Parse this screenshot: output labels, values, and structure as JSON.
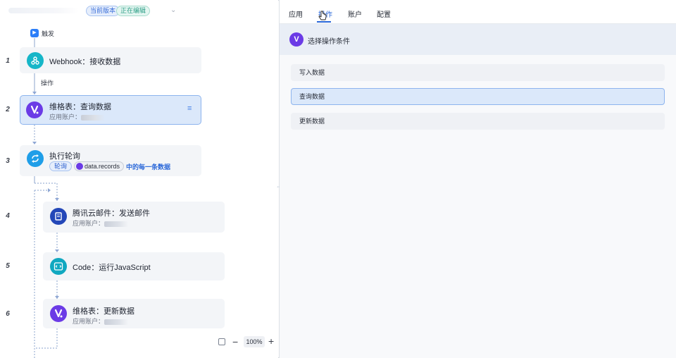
{
  "header": {
    "badge_current": "当前版本",
    "badge_editing": "正在编辑"
  },
  "trigger": {
    "label": "触发"
  },
  "connector": {
    "operation_label": "操作"
  },
  "steps": [
    {
      "number": "1",
      "title": "Webhook：接收数据",
      "icon": "webhook-icon"
    },
    {
      "number": "2",
      "title": "维格表：查询数据",
      "subtitle": "应用账户：",
      "icon": "vika-icon",
      "selected": true
    },
    {
      "number": "3",
      "title": "执行轮询",
      "icon": "loop-icon",
      "chip_poll": "轮询",
      "chip_data": "data.records",
      "chip_suffix": "中的每一条数据"
    },
    {
      "number": "4",
      "title": "腾讯云邮件：发送邮件",
      "subtitle": "应用账户：",
      "icon": "mail-icon"
    },
    {
      "number": "5",
      "title": "Code：运行JavaScript",
      "icon": "code-icon"
    },
    {
      "number": "6",
      "title": "维格表：更新数据",
      "subtitle": "应用账户：",
      "icon": "vika-icon"
    }
  ],
  "zoom": {
    "value": "100%",
    "minus": "−",
    "plus": "+"
  },
  "tabs": [
    {
      "label": "应用"
    },
    {
      "label": "操作",
      "active": true
    },
    {
      "label": "账户"
    },
    {
      "label": "配置"
    }
  ],
  "panel": {
    "section_title": "选择操作条件",
    "section_icon_glyph": "V",
    "options": [
      {
        "label": "写入数据"
      },
      {
        "label": "查询数据",
        "selected": true
      },
      {
        "label": "更新数据"
      }
    ]
  },
  "colors": {
    "accent": "#2b68d9",
    "selected_bg": "#dbe8fa",
    "vika_purple": "#6b3be6",
    "webhook_teal": "#16b6c8"
  }
}
